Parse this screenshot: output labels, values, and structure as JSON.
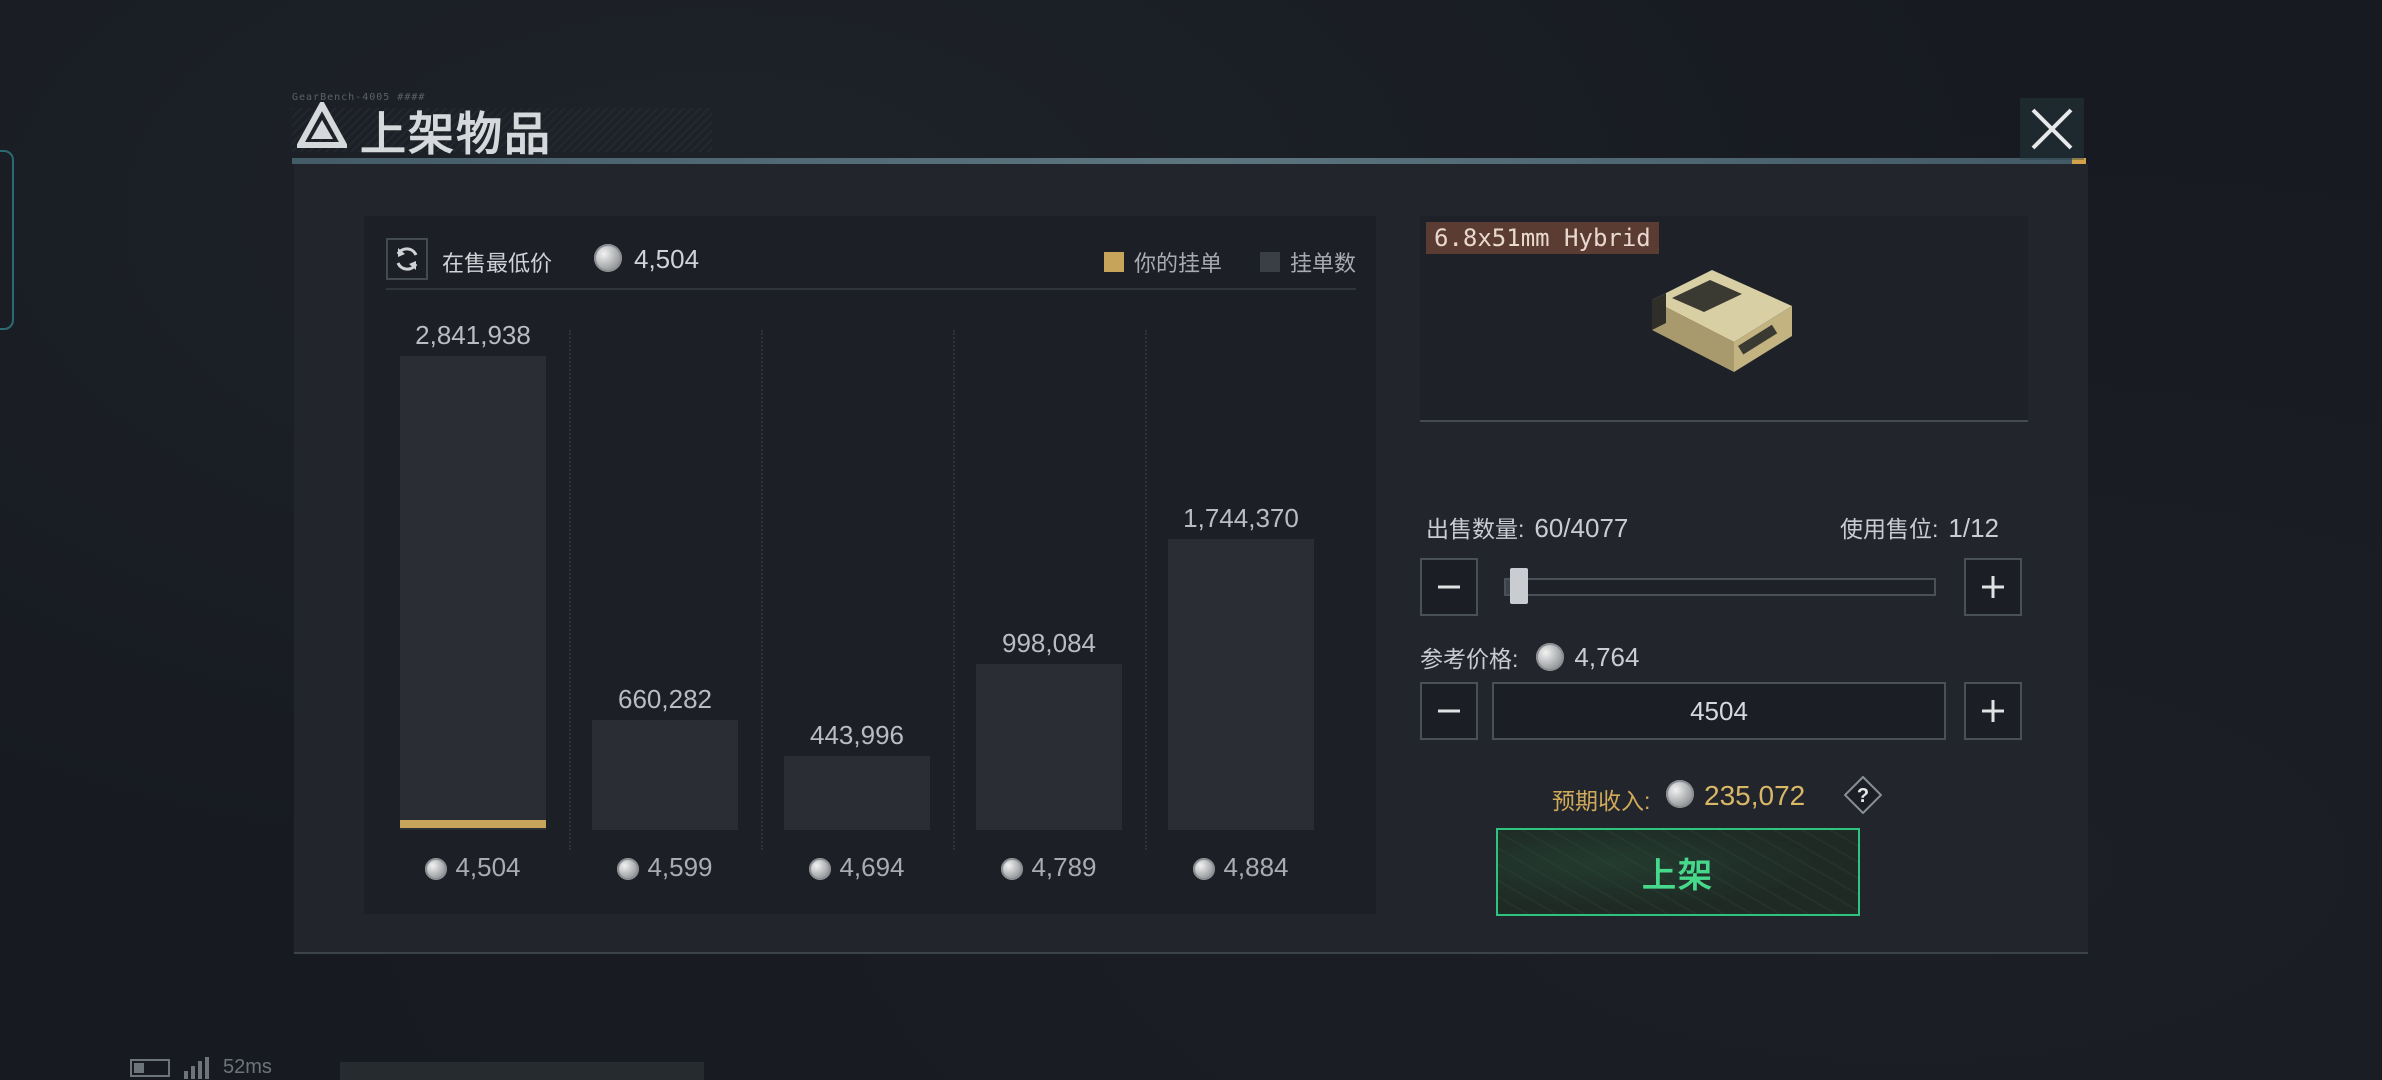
{
  "header": {
    "title": "上架物品",
    "tiny_text": "GearBench-4005 ####"
  },
  "chart_header": {
    "lowest_label": "在售最低价",
    "lowest_value": "4,504",
    "legend": {
      "own_label": "你的挂单",
      "count_label": "挂单数",
      "own_color": "#c6a55b",
      "count_color": "#3a3f46"
    }
  },
  "chart_data": {
    "type": "bar",
    "categories": [
      "4,504",
      "4,599",
      "4,694",
      "4,789",
      "4,884"
    ],
    "values": [
      2841938,
      660282,
      443996,
      998084,
      1744370
    ],
    "value_labels": [
      "2,841,938",
      "660,282",
      "443,996",
      "998,084",
      "1,744,370"
    ],
    "own_listing_price": "4,504",
    "ylim": [
      0,
      3000000
    ]
  },
  "item": {
    "name": "6.8x51mm Hybrid"
  },
  "quantity": {
    "label": "出售数量:",
    "value": "60/4077",
    "slots_label": "使用售位:",
    "slots_value": "1/12",
    "fraction": 0.0147
  },
  "price": {
    "ref_label": "参考价格:",
    "ref_value": "4,764",
    "input_value": "4504"
  },
  "income": {
    "label": "预期收入:",
    "value": "235,072"
  },
  "actions": {
    "list_label": "上架"
  },
  "status": {
    "ping": "52ms"
  },
  "icons": {
    "close": "close-icon",
    "refresh": "refresh-icon",
    "coin": "coin-icon",
    "minus": "minus-icon",
    "plus": "plus-icon",
    "help": "help-icon"
  }
}
